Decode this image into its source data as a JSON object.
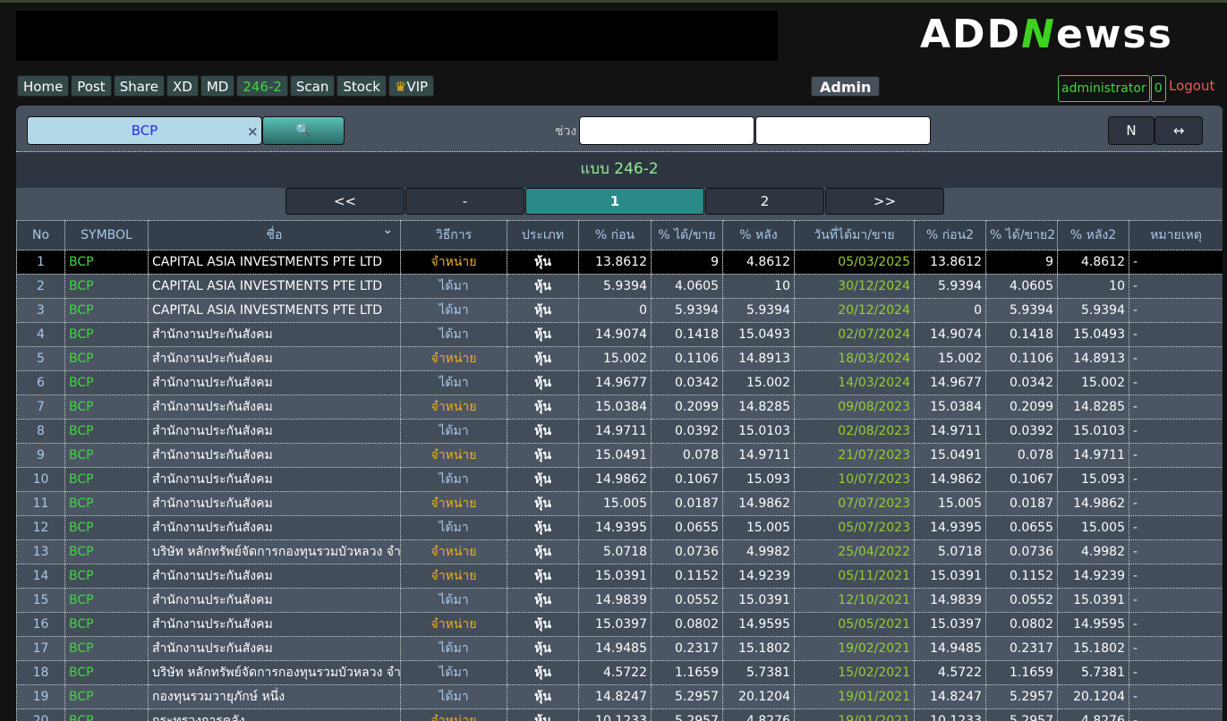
{
  "logo": {
    "text": "ADDNewss",
    "part1": "ADD",
    "part2": "N",
    "part3": "ewss"
  },
  "nav": [
    "Home",
    "Post",
    "Share",
    "XD",
    "MD",
    "246-2",
    "Scan",
    "Stock",
    "VIP"
  ],
  "admin_label": "Admin",
  "user": {
    "name": "administrator",
    "count": "0",
    "logout": "Logout"
  },
  "search": {
    "value": "BCP",
    "clear": "×",
    "range_label": "ช่วง",
    "n_label": "N",
    "swap_label": "↔"
  },
  "title": "แบบ 246-2",
  "pager": [
    "<<",
    "-",
    "1",
    "2",
    ">>"
  ],
  "columns": [
    "No",
    "SYMBOL",
    "ชื่อ",
    "วิธีการ",
    "ประเภท",
    "% ก่อน",
    "% ได้/ขาย",
    "% หลัง",
    "วันที่ได้มา/ขาย",
    "% ก่อน2",
    "% ได้/ขาย2",
    "% หลัง2",
    "หมายเหตุ"
  ],
  "rows": [
    [
      "1",
      "BCP",
      "CAPITAL ASIA INVESTMENTS PTE LTD",
      "จำหน่าย",
      "หุ้น",
      "13.8612",
      "9",
      "4.8612",
      "05/03/2025",
      "13.8612",
      "9",
      "4.8612",
      "-"
    ],
    [
      "2",
      "BCP",
      "CAPITAL ASIA INVESTMENTS PTE LTD",
      "ได้มา",
      "หุ้น",
      "5.9394",
      "4.0605",
      "10",
      "30/12/2024",
      "5.9394",
      "4.0605",
      "10",
      "-"
    ],
    [
      "3",
      "BCP",
      "CAPITAL ASIA INVESTMENTS PTE LTD",
      "ได้มา",
      "หุ้น",
      "0",
      "5.9394",
      "5.9394",
      "20/12/2024",
      "0",
      "5.9394",
      "5.9394",
      "-"
    ],
    [
      "4",
      "BCP",
      "สำนักงานประกันสังคม",
      "ได้มา",
      "หุ้น",
      "14.9074",
      "0.1418",
      "15.0493",
      "02/07/2024",
      "14.9074",
      "0.1418",
      "15.0493",
      "-"
    ],
    [
      "5",
      "BCP",
      "สำนักงานประกันสังคม",
      "จำหน่าย",
      "หุ้น",
      "15.002",
      "0.1106",
      "14.8913",
      "18/03/2024",
      "15.002",
      "0.1106",
      "14.8913",
      "-"
    ],
    [
      "6",
      "BCP",
      "สำนักงานประกันสังคม",
      "ได้มา",
      "หุ้น",
      "14.9677",
      "0.0342",
      "15.002",
      "14/03/2024",
      "14.9677",
      "0.0342",
      "15.002",
      "-"
    ],
    [
      "7",
      "BCP",
      "สำนักงานประกันสังคม",
      "จำหน่าย",
      "หุ้น",
      "15.0384",
      "0.2099",
      "14.8285",
      "09/08/2023",
      "15.0384",
      "0.2099",
      "14.8285",
      "-"
    ],
    [
      "8",
      "BCP",
      "สำนักงานประกันสังคม",
      "ได้มา",
      "หุ้น",
      "14.9711",
      "0.0392",
      "15.0103",
      "02/08/2023",
      "14.9711",
      "0.0392",
      "15.0103",
      "-"
    ],
    [
      "9",
      "BCP",
      "สำนักงานประกันสังคม",
      "จำหน่าย",
      "หุ้น",
      "15.0491",
      "0.078",
      "14.9711",
      "21/07/2023",
      "15.0491",
      "0.078",
      "14.9711",
      "-"
    ],
    [
      "10",
      "BCP",
      "สำนักงานประกันสังคม",
      "ได้มา",
      "หุ้น",
      "14.9862",
      "0.1067",
      "15.093",
      "10/07/2023",
      "14.9862",
      "0.1067",
      "15.093",
      "-"
    ],
    [
      "11",
      "BCP",
      "สำนักงานประกันสังคม",
      "จำหน่าย",
      "หุ้น",
      "15.005",
      "0.0187",
      "14.9862",
      "07/07/2023",
      "15.005",
      "0.0187",
      "14.9862",
      "-"
    ],
    [
      "12",
      "BCP",
      "สำนักงานประกันสังคม",
      "ได้มา",
      "หุ้น",
      "14.9395",
      "0.0655",
      "15.005",
      "05/07/2023",
      "14.9395",
      "0.0655",
      "15.005",
      "-"
    ],
    [
      "13",
      "BCP",
      "บริษัท หลักทรัพย์จัดการกองทุนรวมบัวหลวง จำกัด",
      "จำหน่าย",
      "หุ้น",
      "5.0718",
      "0.0736",
      "4.9982",
      "25/04/2022",
      "5.0718",
      "0.0736",
      "4.9982",
      "-"
    ],
    [
      "14",
      "BCP",
      "สำนักงานประกันสังคม",
      "จำหน่าย",
      "หุ้น",
      "15.0391",
      "0.1152",
      "14.9239",
      "05/11/2021",
      "15.0391",
      "0.1152",
      "14.9239",
      "-"
    ],
    [
      "15",
      "BCP",
      "สำนักงานประกันสังคม",
      "ได้มา",
      "หุ้น",
      "14.9839",
      "0.0552",
      "15.0391",
      "12/10/2021",
      "14.9839",
      "0.0552",
      "15.0391",
      "-"
    ],
    [
      "16",
      "BCP",
      "สำนักงานประกันสังคม",
      "จำหน่าย",
      "หุ้น",
      "15.0397",
      "0.0802",
      "14.9595",
      "05/05/2021",
      "15.0397",
      "0.0802",
      "14.9595",
      "-"
    ],
    [
      "17",
      "BCP",
      "สำนักงานประกันสังคม",
      "ได้มา",
      "หุ้น",
      "14.9485",
      "0.2317",
      "15.1802",
      "19/02/2021",
      "14.9485",
      "0.2317",
      "15.1802",
      "-"
    ],
    [
      "18",
      "BCP",
      "บริษัท หลักทรัพย์จัดการกองทุนรวมบัวหลวง จำกัด",
      "ได้มา",
      "หุ้น",
      "4.5722",
      "1.1659",
      "5.7381",
      "15/02/2021",
      "4.5722",
      "1.1659",
      "5.7381",
      "-"
    ],
    [
      "19",
      "BCP",
      "กองทุนรวมวายุภักษ์ หนึ่ง",
      "ได้มา",
      "หุ้น",
      "14.8247",
      "5.2957",
      "20.1204",
      "19/01/2021",
      "14.8247",
      "5.2957",
      "20.1204",
      "-"
    ],
    [
      "20",
      "BCP",
      "กระทรวงการคลัง",
      "จำหน่าย",
      "หุ้น",
      "10.1233",
      "5.2957",
      "4.8276",
      "19/01/2021",
      "10.1233",
      "5.2957",
      "4.8276",
      "-"
    ]
  ],
  "colors": {
    "green": "#3fd83f",
    "sell": "#f0b020",
    "buy": "#a8c8e8",
    "date": "#9acd32",
    "accent": "#2a8a88"
  }
}
